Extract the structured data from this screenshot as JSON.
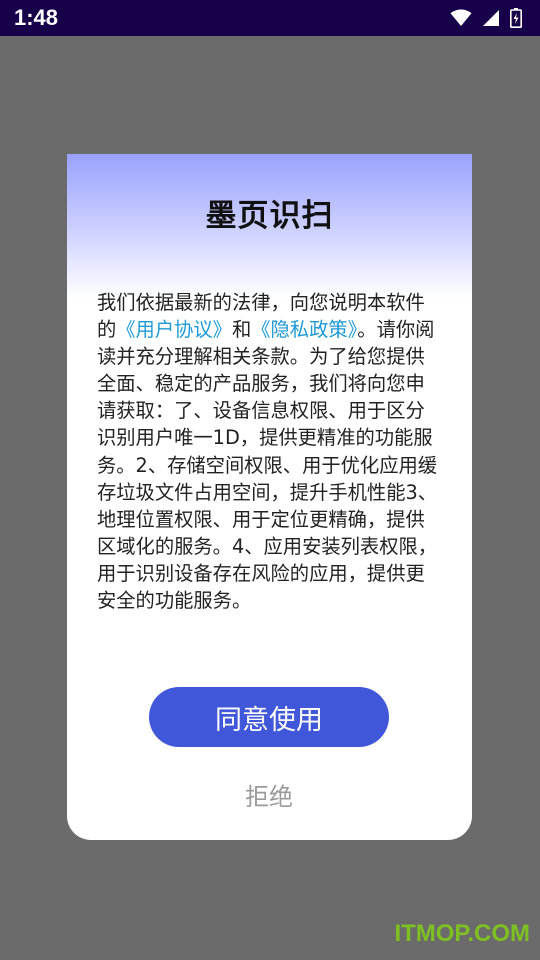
{
  "status_bar": {
    "time": "1:48",
    "icons": [
      "wifi-icon",
      "signal-icon",
      "battery-charging-icon"
    ]
  },
  "dialog": {
    "title": "墨页识扫",
    "body": {
      "intro": "我们依据最新的法律，向您说明本软件的",
      "user_agreement_link": "《用户协议》",
      "and": "和",
      "privacy_policy_link": "《隐私政策》",
      "rest": "。请你阅读并充分理解相关条款。为了给您提供全面、稳定的产品服务，我们将向您申请获取：了、设备信息权限、用于区分识别用户唯一1D，提供更精准的功能服务。2、存储空间权限、用于优化应用缓存垃圾文件占用空间，提升手机性能3、地理位置权限、用于定位更精确，提供区域化的服务。4、应用安装列表权限，用于识别设备存在风险的应用，提供更安全的功能服务。"
    },
    "agree_label": "同意使用",
    "refuse_label": "拒绝"
  },
  "colors": {
    "status_bar": "#17004a",
    "overlay": "#6b6b6b",
    "link": "#1b9ad6",
    "agree_button": "#3f57d8",
    "refuse_text": "#9a9a9a",
    "watermark": "#7ec021"
  },
  "watermark": "ITMOP.COM"
}
